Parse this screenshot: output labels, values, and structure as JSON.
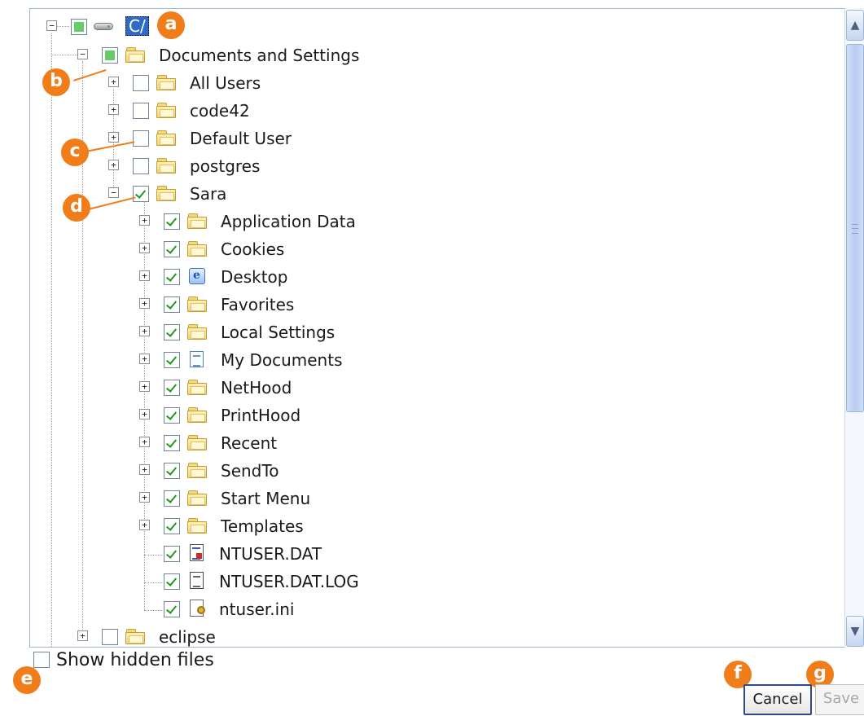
{
  "tree": {
    "root": {
      "label": "C/"
    },
    "items": [
      {
        "label": "Documents and Settings"
      },
      {
        "label": "All Users"
      },
      {
        "label": "code42"
      },
      {
        "label": "Default User"
      },
      {
        "label": "postgres"
      },
      {
        "label": "Sara"
      },
      {
        "label": "Application Data"
      },
      {
        "label": "Cookies"
      },
      {
        "label": "Desktop"
      },
      {
        "label": "Favorites"
      },
      {
        "label": "Local Settings"
      },
      {
        "label": "My Documents"
      },
      {
        "label": "NetHood"
      },
      {
        "label": "PrintHood"
      },
      {
        "label": "Recent"
      },
      {
        "label": "SendTo"
      },
      {
        "label": "Start Menu"
      },
      {
        "label": "Templates"
      },
      {
        "label": "NTUSER.DAT"
      },
      {
        "label": "NTUSER.DAT.LOG"
      },
      {
        "label": "ntuser.ini"
      },
      {
        "label": "eclipse"
      }
    ]
  },
  "options": {
    "show_hidden_label": "Show hidden files"
  },
  "buttons": {
    "cancel": "Cancel",
    "save": "Save"
  },
  "callouts": {
    "a": "a",
    "b": "b",
    "c": "c",
    "d": "d",
    "e": "e",
    "f": "f",
    "g": "g"
  },
  "colors": {
    "accent": "#f07d1a",
    "selection": "#316ac5",
    "check": "#1d9a1d",
    "partial": "#66cc66"
  },
  "icons": {
    "expanded": "minus-box",
    "collapsed": "plus-box",
    "drive": "hard-drive-icon",
    "folder": "folder-icon"
  }
}
